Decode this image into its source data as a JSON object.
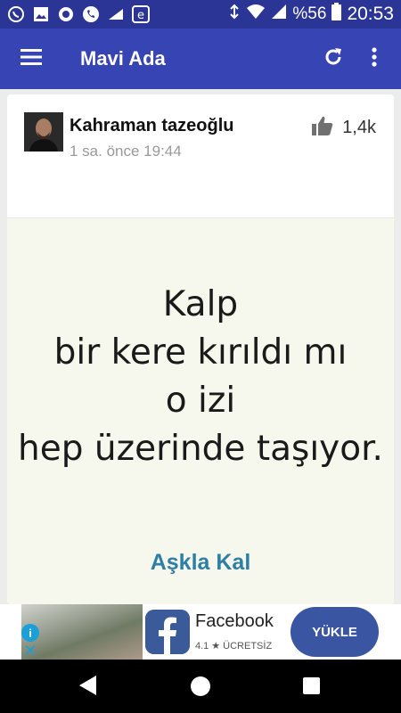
{
  "status_bar": {
    "battery": "%56",
    "time": "20:53",
    "left_icons": [
      "whatsapp-icon",
      "image-icon",
      "circle-app-icon",
      "phone-icon",
      "me-icon",
      "e-app-icon"
    ]
  },
  "app_bar": {
    "title": "Mavi Ada",
    "menu_icon": "hamburger-icon",
    "refresh_icon": "refresh-icon",
    "more_icon": "more-vert-icon"
  },
  "post": {
    "author": "Kahraman tazeoğlu",
    "time": "1 sa. önce 19:44",
    "likes": "1,4k",
    "quote_lines": [
      "Kalp",
      "bir kere kırıldı mı",
      "o izi",
      "hep üzerinde taşıyor."
    ],
    "source": "Aşkla Kal"
  },
  "ad": {
    "app_name": "Facebook",
    "rating": "4.1",
    "rating_star": "★",
    "price_label": "ÜCRETSİZ",
    "install_label": "YÜKLE",
    "info_glyph": "i",
    "close_glyph": "✕"
  },
  "colors": {
    "status_bar": "#2b3595",
    "app_bar": "#3744b4",
    "quote_bg": "#f7f8ed",
    "source_text": "#2e7fa3",
    "ad_button": "#3a55a2"
  }
}
